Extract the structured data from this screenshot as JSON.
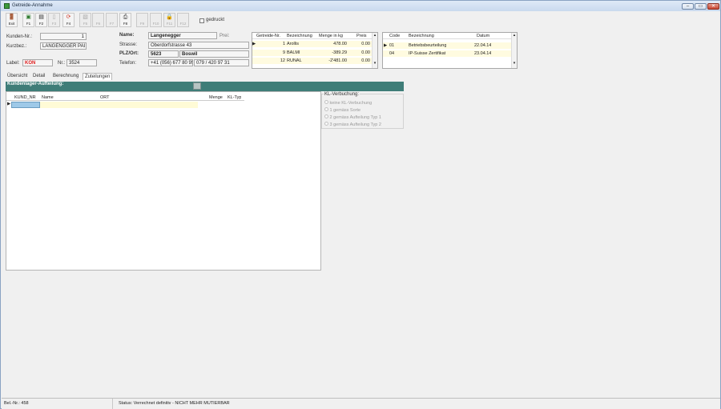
{
  "window": {
    "title": "Getreide-Annahme",
    "min_label": "–",
    "max_label": "▭",
    "close_label": "✕"
  },
  "toolbar": {
    "items": [
      {
        "label": "Exit",
        "icon": "door-icon",
        "enabled": true
      },
      {
        "label": "F1",
        "icon": "document-check-icon",
        "enabled": true
      },
      {
        "label": "F2",
        "icon": "copy-icon",
        "enabled": false
      },
      {
        "label": "F3",
        "icon": "page-icon",
        "enabled": false
      },
      {
        "label": "F4",
        "icon": "refresh-icon",
        "enabled": true
      },
      {
        "label": "F5",
        "icon": "image-icon",
        "enabled": false
      },
      {
        "label": "F6",
        "icon": "blank-icon",
        "enabled": false
      },
      {
        "label": "F7",
        "icon": "blank-icon",
        "enabled": false
      },
      {
        "label": "F8",
        "icon": "printer-icon",
        "enabled": true
      },
      {
        "label": "F9",
        "icon": "blank-icon",
        "enabled": false
      },
      {
        "label": "F10",
        "icon": "blank-icon",
        "enabled": false
      },
      {
        "label": "F11",
        "icon": "lock-icon",
        "enabled": false
      },
      {
        "label": "F12",
        "icon": "blank-icon",
        "enabled": false
      }
    ],
    "gedruckt_label": "gedruckt"
  },
  "left": {
    "kunden_nr_label": "Kunden-Nr.:",
    "kunden_nr": "1",
    "kurzbez_label": "Kurzbez.:",
    "kurzbez": "LANGENGGER PAI",
    "label_label": "Label:",
    "label_value": "KON",
    "nr_label": "Nr.:",
    "nr": "3524"
  },
  "address": {
    "name_label": "Name:",
    "name": "Langenegger",
    "prei_label": "Prei:",
    "strasse_label": "Strasse:",
    "strasse": "Oberdorfstrasse 43",
    "plz_label": "PLZ/Ort:",
    "plz": "5623",
    "ort": "Boswil",
    "telefon_label": "Telefon:",
    "telefon1": "+41 (056) 677 80 95",
    "telefon2": "079 / 420 97 31"
  },
  "getreide": {
    "headers": [
      "Getreide-Nr.",
      "Bezeichnung",
      "Menge in kg",
      "Preis"
    ],
    "rows": [
      [
        "1",
        "Arollis",
        "478.00",
        "0.00"
      ],
      [
        "9",
        "BALMI",
        "-389.29",
        "0.00"
      ],
      [
        "12",
        "RUNAL",
        "-2'481.00",
        "0.00"
      ]
    ]
  },
  "certs": {
    "headers": [
      "Code",
      "Bezeichnung",
      "Datum"
    ],
    "rows": [
      [
        "01",
        "Betriebsbeurteilung",
        "22.04.14"
      ],
      [
        "04",
        "IP-Suisse Zertifikat",
        "23.04.14"
      ]
    ]
  },
  "tabs": [
    "Übersicht",
    "Detail",
    "Berechnung",
    "Zuteilungen"
  ],
  "section": {
    "title": "Kundenlager-Aufteilung:"
  },
  "kl_grid": {
    "headers": [
      "KUND_NR",
      "Name",
      "ORT",
      "Menge",
      "KL-Typ"
    ]
  },
  "kl_verbuchung": {
    "title": "KL-Verbuchung:",
    "options": [
      "keine KL-Verbuchung",
      "1 gemäss Sorte",
      "2 gemäss Aufteilung Typ 1",
      "3 gemäss Aufteilung Typ 2"
    ]
  },
  "status": {
    "bel_nr": "Bel.-Nr.: 458",
    "text": "Status: Verrechnet definitiv - NICHT MEHR MUTIERBAR"
  }
}
